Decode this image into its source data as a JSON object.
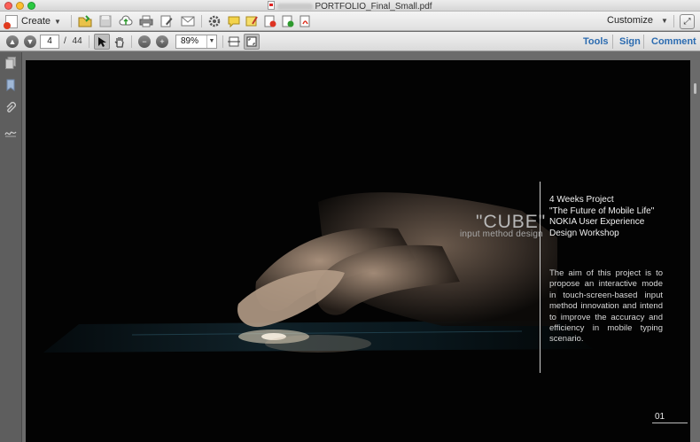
{
  "window": {
    "title": "PORTFOLIO_Final_Small.pdf"
  },
  "toolbar1": {
    "create_label": "Create",
    "customize_label": "Customize",
    "icons": [
      "open-folder-icon",
      "save-icon",
      "cloud-upload-icon",
      "print-icon",
      "edit-document-icon",
      "email-icon",
      "settings-gear-icon",
      "comment-bubble-icon",
      "highlight-note-icon",
      "pdf-stamp-icon",
      "export-icon",
      "sign-icon"
    ]
  },
  "toolbar2": {
    "current_page": "4",
    "page_total": "/ 44",
    "zoom": "89%",
    "links": {
      "tools": "Tools",
      "sign": "Sign",
      "comment": "Comment"
    }
  },
  "navpane": {
    "icons": [
      "pages-icon",
      "bookmark-icon",
      "attachment-icon",
      "signature-icon"
    ]
  },
  "document": {
    "cube_title": "\"CUBE\"",
    "cube_subtitle": "input method design",
    "heading_lines": [
      "4 Weeks Project",
      "\"The Future of Mobile Life\"",
      "NOKIA User Experience",
      "Design Workshop"
    ],
    "description": "The aim of this project is to propose an interactive mode in touch-screen-based input method innovation and intend to improve the accuracy and efficiency in mobile typing scenario.",
    "page_number": "01"
  },
  "colors": {
    "link_blue": "#2b6bb0",
    "page_background": "#030303",
    "chrome_gray": "#6b6b6b"
  }
}
